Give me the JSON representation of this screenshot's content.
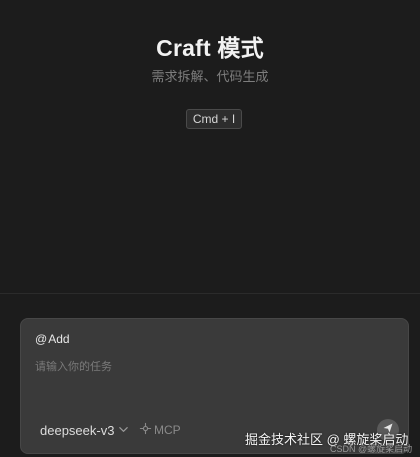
{
  "hero": {
    "title": "Craft 模式",
    "subtitle": "需求拆解、代码生成",
    "shortcut": "Cmd + I"
  },
  "composer": {
    "add_symbol": "@",
    "add_label": "Add",
    "input_placeholder": "请输入你的任务",
    "input_value": "",
    "model_label": "deepseek-v3",
    "mcp_label": "MCP",
    "send_icon": "send-icon"
  },
  "watermark": {
    "main": "掘金技术社区 @ 螺旋桨启动",
    "sub": "CSDN @螺旋桨启动"
  },
  "colors": {
    "background": "#1c1c1c",
    "composer_bg": "#3a3a3a",
    "title": "#f2f2f2",
    "muted": "#7d7d7d"
  }
}
